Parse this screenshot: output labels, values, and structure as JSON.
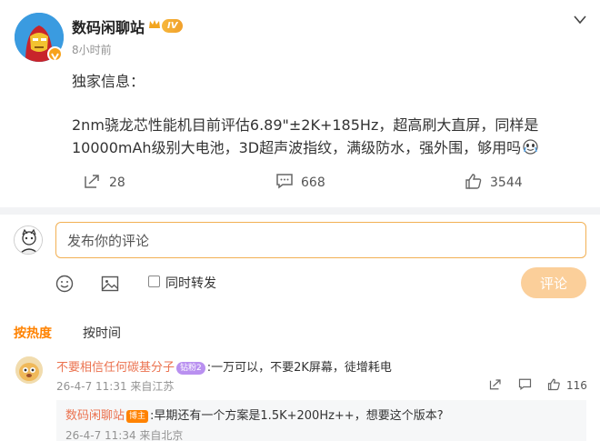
{
  "post": {
    "username": "数码闲聊站",
    "level_badge": "IV",
    "time": "8小时前",
    "text_line1": "独家信息：",
    "text_line2": "2nm骁龙芯性能机目前评估6.89\"±2K+185Hz，超高刷大直屏，同样是",
    "text_line3": "10000mAh级别大电池，3D超声波指纹，满级防水，强外围，够用吗"
  },
  "actions": {
    "repost_count": "28",
    "comment_count": "668",
    "like_count": "3544"
  },
  "composer": {
    "placeholder": "发布你的评论",
    "repost_label": "同时转发",
    "submit_label": "评论"
  },
  "tabs": [
    {
      "label": "按热度",
      "active": true
    },
    {
      "label": "按时间",
      "active": false
    }
  ],
  "comments": [
    {
      "name": "不要相信任何碳基分子",
      "medal": "钻粉2",
      "text": ":一万可以，不要2K屏幕，徒增耗电",
      "meta": "26-4-7 11:31 来自江苏",
      "like_count": "116",
      "reply": {
        "name": "数码闲聊站",
        "badge": "博主",
        "text": ":早期还有一个方案是1.5K+200Hz++，想要这个版本?",
        "meta": "26-4-7 11:34 来自北京"
      }
    }
  ],
  "colors": {
    "accent": "#ff8200",
    "name_link": "#eb7350",
    "input_border": "#f2b054",
    "submit_bg": "#fbcf9a"
  }
}
